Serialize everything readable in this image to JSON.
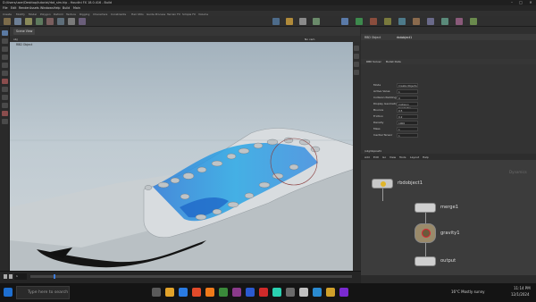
{
  "window": {
    "title": "D:/Users/user/Desktop/tutorial/rbd_sim.hip - Houdini FX 18.0.416 - Build",
    "controls": [
      "–",
      "□",
      "✕"
    ]
  },
  "menu": [
    "File",
    "Edit",
    "Render",
    "Assets",
    "Windows",
    "Help",
    "Build",
    "Main"
  ],
  "shelf_tabs": [
    "Create",
    "Modify",
    "Model",
    "Polygon",
    "Deform",
    "Texture",
    "Rigging",
    "Characters",
    "Constraints",
    "Hair Utils",
    "Guide Process",
    "Terrain FX",
    "Simple FX",
    "Volume"
  ],
  "viewport": {
    "tab_label": "Scene View",
    "path_label": "obj",
    "object_label": "RBD Object",
    "camera_menu": "No cam"
  },
  "timeline": {
    "frame": "1"
  },
  "params": {
    "node_title": "RBD Object",
    "node_name": "rbdobject1",
    "tabs": [
      "RBD Solver",
      "Bullet Data"
    ],
    "rows": [
      {
        "label": "Mode",
        "value": "Create Objects"
      },
      {
        "label": "Active Value",
        "value": "1"
      },
      {
        "label": "Collision Padding",
        "value": "0"
      },
      {
        "label": "Display Geometry",
        "value": "Collision Geometry"
      },
      {
        "label": "Bounce",
        "value": "0.5"
      },
      {
        "label": "Friction",
        "value": "0.2"
      },
      {
        "label": "Density",
        "value": "1000"
      },
      {
        "label": "Mass",
        "value": "1"
      },
      {
        "label": "Inertial Tensor",
        "value": "1"
      }
    ]
  },
  "network": {
    "tab_label": "/obj/dopnet1",
    "menu": [
      "Add",
      "Edit",
      "Go",
      "View",
      "Tools",
      "Layout",
      "Help"
    ],
    "context_label": "Dynamics",
    "nodes": [
      {
        "name": "rbdobject1"
      },
      {
        "name": "merge1"
      },
      {
        "name": "gravity1"
      },
      {
        "name": "output"
      }
    ]
  },
  "taskbar": {
    "search_placeholder": "Type here to search",
    "weather": "16°C Mostly sunny",
    "time": "11:14 PM",
    "date": "12/1/2024"
  }
}
